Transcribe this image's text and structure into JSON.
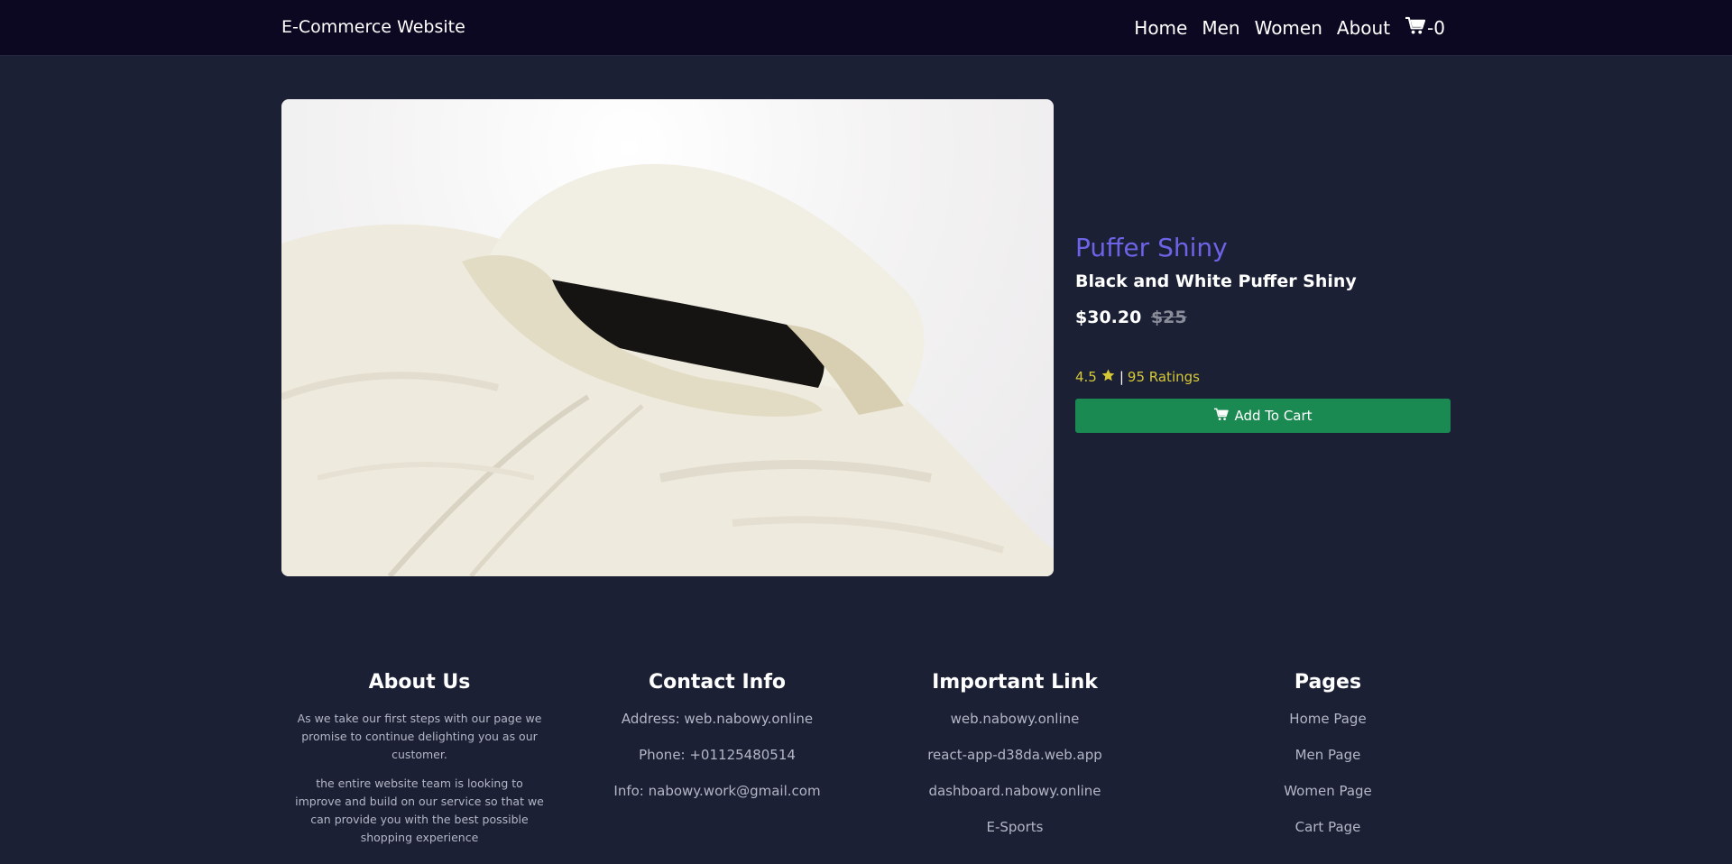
{
  "navbar": {
    "brand": "E-Commerce Website",
    "links": [
      "Home",
      "Men",
      "Women",
      "About"
    ],
    "cart_count": "-0"
  },
  "product": {
    "title": "Puffer Shiny",
    "subtitle": "Black and White Puffer Shiny",
    "price": "$30.20",
    "old_price": "$25",
    "rating": "4.5",
    "separator": "|",
    "ratings_count": "95 Ratings",
    "add_to_cart": "Add To Cart",
    "image_icon": "puffer-jacket-image"
  },
  "footer": {
    "about": {
      "title": "About Us",
      "para1": "As we take our first steps with our page we promise to continue delighting you as our customer.",
      "para2": "the entire website team is looking to improve and build on our service so that we can provide you with the best possible shopping experience"
    },
    "contact": {
      "title": "Contact Info",
      "lines": [
        "Address: web.nabowy.online",
        "Phone: +01125480514",
        "Info: nabowy.work@gmail.com"
      ]
    },
    "links": {
      "title": "Important Link",
      "items": [
        "web.nabowy.online",
        "react-app-d38da.web.app",
        "dashboard.nabowy.online",
        "E-Sports"
      ]
    },
    "pages": {
      "title": "Pages",
      "items": [
        "Home Page",
        "Men Page",
        "Women Page",
        "Cart Page"
      ]
    }
  },
  "colors": {
    "background": "#1b2035",
    "navbar": "#0d0821",
    "title": "#6d63e6",
    "rating": "#d6c936",
    "button": "#1b8a52"
  }
}
